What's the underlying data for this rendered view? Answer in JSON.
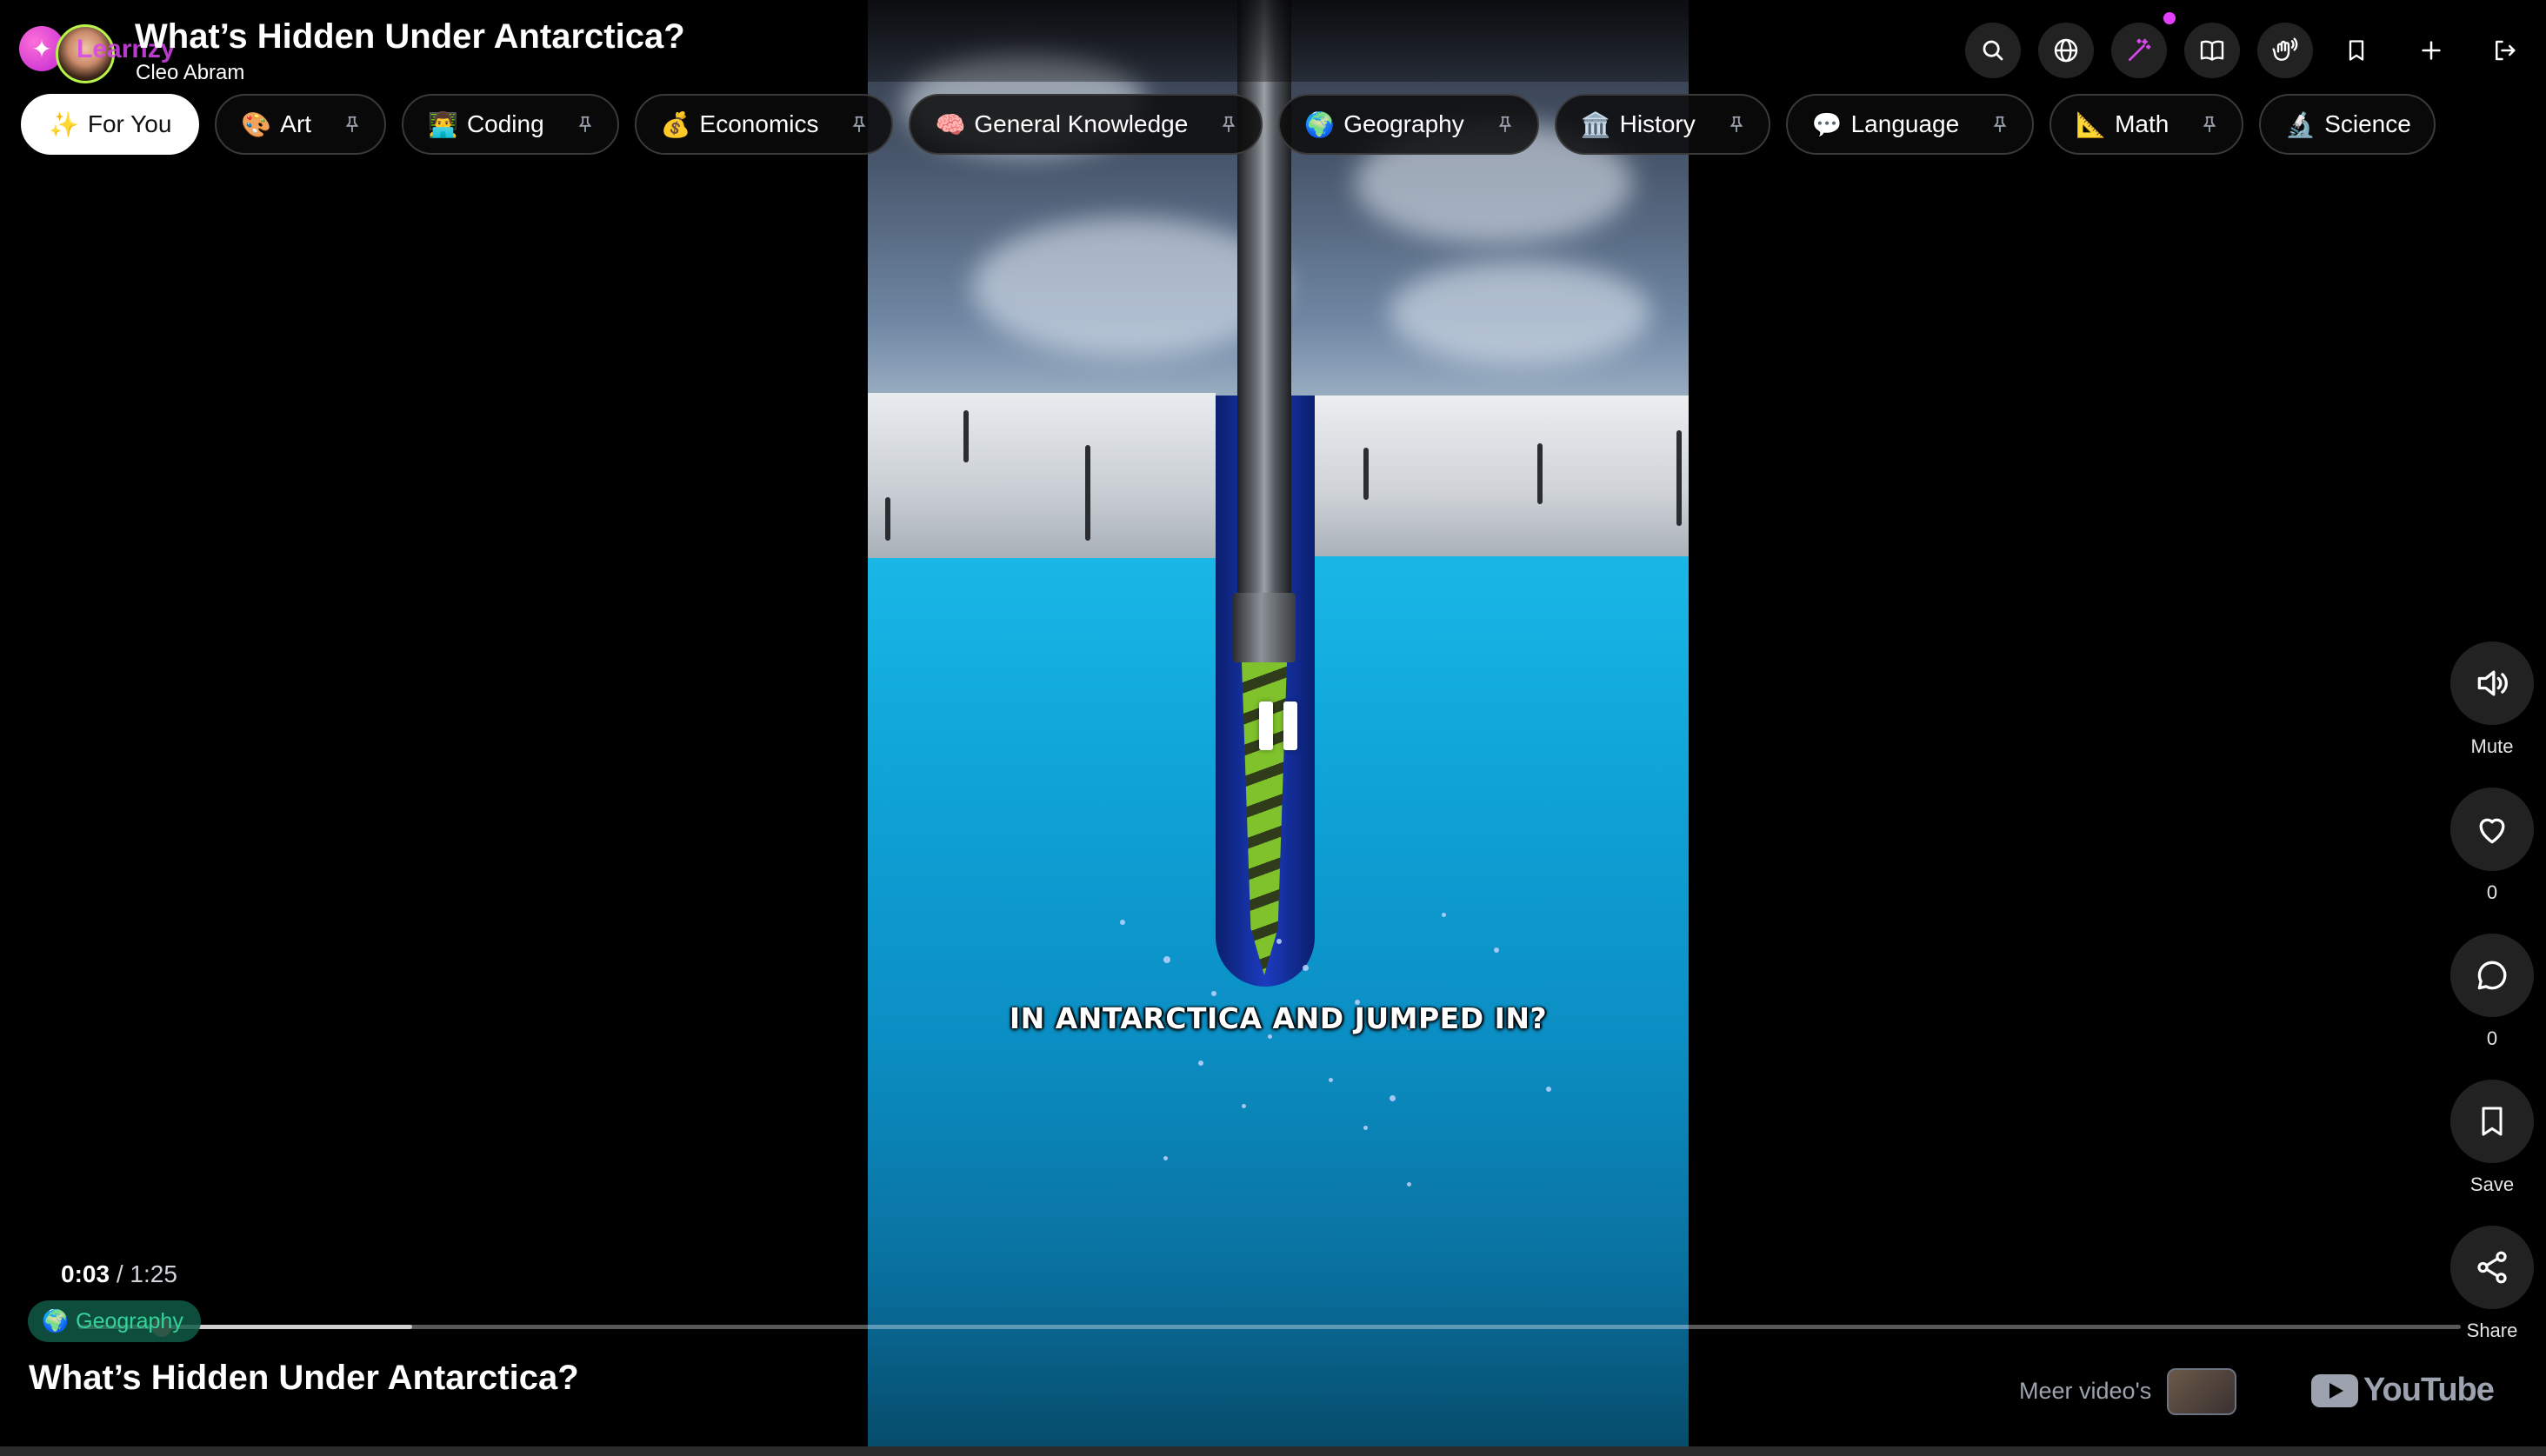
{
  "app": {
    "brand": "Learnzy",
    "video_title": "What’s Hidden Under Antarctica?",
    "channel": "Cleo Abram"
  },
  "toolbar": {
    "icons": [
      "search-icon",
      "globe-icon",
      "magic-wand-icon",
      "book-icon",
      "sign-language-icon",
      "bookmark-icon",
      "plus-icon",
      "logout-icon"
    ]
  },
  "categories": [
    {
      "label": "For You",
      "emoji": "✨",
      "active": true
    },
    {
      "label": "Art",
      "emoji": "🎨"
    },
    {
      "label": "Coding",
      "emoji": "👨‍💻"
    },
    {
      "label": "Economics",
      "emoji": "💰"
    },
    {
      "label": "General Knowledge",
      "emoji": "🧠"
    },
    {
      "label": "Geography",
      "emoji": "🌍"
    },
    {
      "label": "History",
      "emoji": "🏛️"
    },
    {
      "label": "Language",
      "emoji": "💬"
    },
    {
      "label": "Math",
      "emoji": "📐"
    },
    {
      "label": "Science",
      "emoji": "🔬"
    }
  ],
  "video": {
    "caption": "IN ANTARCTICA AND JUMPED IN?",
    "state": "playing",
    "progress_fraction": 0.035
  },
  "player": {
    "current_time": "0:03",
    "separator": " / ",
    "duration": "1:25",
    "topic_badge": "Geography",
    "topic_emoji": "🌍",
    "title": "What’s Hidden Under Antarctica?",
    "more_videos": "Meer video's",
    "youtube": "YouTube"
  },
  "actions": [
    {
      "name": "mute",
      "label": "Mute",
      "icon": "speaker-icon"
    },
    {
      "name": "like",
      "label": "0",
      "icon": "heart-icon"
    },
    {
      "name": "comment",
      "label": "0",
      "icon": "comment-icon"
    },
    {
      "name": "save",
      "label": "Save",
      "icon": "bookmark-icon"
    },
    {
      "name": "share",
      "label": "Share",
      "icon": "share-icon"
    }
  ],
  "colors": {
    "accent": "#d946ef",
    "topic_badge_text": "#34d399",
    "progress_knob": "#e2483d"
  }
}
